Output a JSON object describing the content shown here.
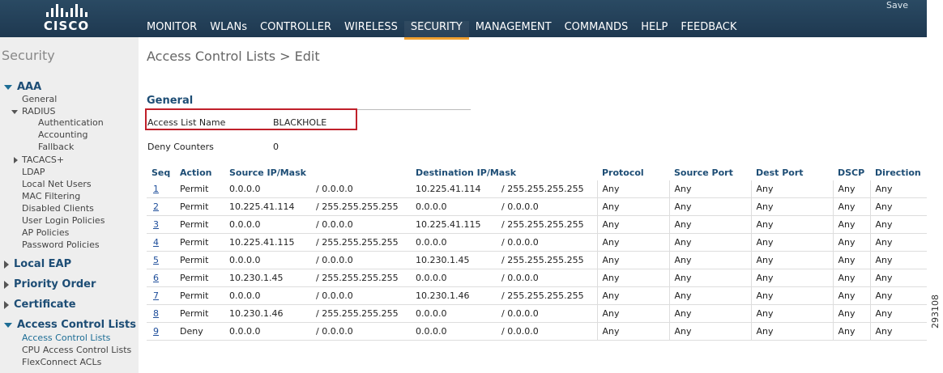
{
  "header": {
    "logo_text": "CISCO",
    "save_label": "Save",
    "nav": [
      {
        "label": "MONITOR"
      },
      {
        "label": "WLANs"
      },
      {
        "label": "CONTROLLER"
      },
      {
        "label": "WIRELESS"
      },
      {
        "label": "SECURITY",
        "active": true
      },
      {
        "label": "MANAGEMENT"
      },
      {
        "label": "COMMANDS"
      },
      {
        "label": "HELP"
      },
      {
        "label": "FEEDBACK"
      }
    ],
    "colors": {
      "bar": "#1e3850",
      "active_underline": "#f0a030"
    }
  },
  "sidebar": {
    "title": "Security",
    "aaa": {
      "label": "AAA",
      "items": [
        "General"
      ],
      "radius": {
        "label": "RADIUS",
        "items": [
          "Authentication",
          "Accounting",
          "Fallback"
        ]
      },
      "tacacs": "TACACS+",
      "more": [
        "LDAP",
        "Local Net Users",
        "MAC Filtering",
        "Disabled Clients",
        "User Login Policies",
        "AP Policies",
        "Password Policies"
      ]
    },
    "groups": [
      "Local EAP",
      "Priority Order",
      "Certificate"
    ],
    "acl_group": {
      "label": "Access Control Lists",
      "items": [
        "Access Control Lists",
        "CPU Access Control Lists",
        "FlexConnect ACLs"
      ]
    }
  },
  "main": {
    "title": "Access Control Lists > Edit",
    "general_heading": "General",
    "access_list_name_label": "Access List Name",
    "access_list_name_value": "BLACKHOLE",
    "deny_counters_label": "Deny Counters",
    "deny_counters_value": "0",
    "table": {
      "headers": [
        "Seq",
        "Action",
        "Source IP/Mask",
        "Destination IP/Mask",
        "Protocol",
        "Source Port",
        "Dest Port",
        "DSCP",
        "Direction"
      ],
      "rows": [
        {
          "seq": "1",
          "action": "Permit",
          "src_ip": "0.0.0.0",
          "src_mask": "/ 0.0.0.0",
          "dst_ip": "10.225.41.114",
          "dst_mask": "/ 255.255.255.255",
          "protocol": "Any",
          "src_port": "Any",
          "dst_port": "Any",
          "dscp": "Any",
          "direction": "Any"
        },
        {
          "seq": "2",
          "action": "Permit",
          "src_ip": "10.225.41.114",
          "src_mask": "/ 255.255.255.255",
          "dst_ip": "0.0.0.0",
          "dst_mask": "/ 0.0.0.0",
          "protocol": "Any",
          "src_port": "Any",
          "dst_port": "Any",
          "dscp": "Any",
          "direction": "Any"
        },
        {
          "seq": "3",
          "action": "Permit",
          "src_ip": "0.0.0.0",
          "src_mask": "/ 0.0.0.0",
          "dst_ip": "10.225.41.115",
          "dst_mask": "/ 255.255.255.255",
          "protocol": "Any",
          "src_port": "Any",
          "dst_port": "Any",
          "dscp": "Any",
          "direction": "Any"
        },
        {
          "seq": "4",
          "action": "Permit",
          "src_ip": "10.225.41.115",
          "src_mask": "/ 255.255.255.255",
          "dst_ip": "0.0.0.0",
          "dst_mask": "/ 0.0.0.0",
          "protocol": "Any",
          "src_port": "Any",
          "dst_port": "Any",
          "dscp": "Any",
          "direction": "Any"
        },
        {
          "seq": "5",
          "action": "Permit",
          "src_ip": "0.0.0.0",
          "src_mask": "/ 0.0.0.0",
          "dst_ip": "10.230.1.45",
          "dst_mask": "/ 255.255.255.255",
          "protocol": "Any",
          "src_port": "Any",
          "dst_port": "Any",
          "dscp": "Any",
          "direction": "Any"
        },
        {
          "seq": "6",
          "action": "Permit",
          "src_ip": "10.230.1.45",
          "src_mask": "/ 255.255.255.255",
          "dst_ip": "0.0.0.0",
          "dst_mask": "/ 0.0.0.0",
          "protocol": "Any",
          "src_port": "Any",
          "dst_port": "Any",
          "dscp": "Any",
          "direction": "Any"
        },
        {
          "seq": "7",
          "action": "Permit",
          "src_ip": "0.0.0.0",
          "src_mask": "/ 0.0.0.0",
          "dst_ip": "10.230.1.46",
          "dst_mask": "/ 255.255.255.255",
          "protocol": "Any",
          "src_port": "Any",
          "dst_port": "Any",
          "dscp": "Any",
          "direction": "Any"
        },
        {
          "seq": "8",
          "action": "Permit",
          "src_ip": "10.230.1.46",
          "src_mask": "/ 255.255.255.255",
          "dst_ip": "0.0.0.0",
          "dst_mask": "/ 0.0.0.0",
          "protocol": "Any",
          "src_port": "Any",
          "dst_port": "Any",
          "dscp": "Any",
          "direction": "Any"
        },
        {
          "seq": "9",
          "action": "Deny",
          "src_ip": "0.0.0.0",
          "src_mask": "/ 0.0.0.0",
          "dst_ip": "0.0.0.0",
          "dst_mask": "/ 0.0.0.0",
          "protocol": "Any",
          "src_port": "Any",
          "dst_port": "Any",
          "dscp": "Any",
          "direction": "Any"
        }
      ]
    }
  },
  "figure_id": "293108"
}
